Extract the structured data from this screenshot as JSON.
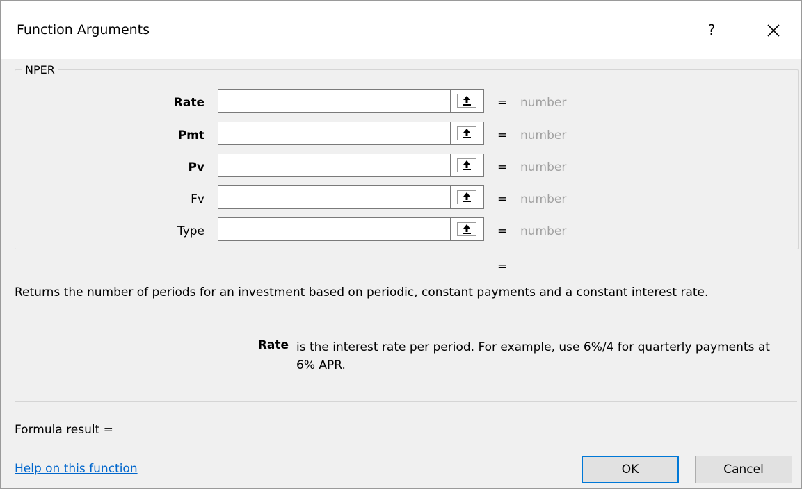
{
  "dialog": {
    "title": "Function Arguments",
    "help_glyph": "?",
    "close_icon": "close-icon"
  },
  "function_group": {
    "name": "NPER",
    "arguments": [
      {
        "label": "Rate",
        "bold": true,
        "value": "",
        "result_eq": "=",
        "result_value": "number"
      },
      {
        "label": "Pmt",
        "bold": true,
        "value": "",
        "result_eq": "=",
        "result_value": "number"
      },
      {
        "label": "Pv",
        "bold": true,
        "value": "",
        "result_eq": "=",
        "result_value": "number"
      },
      {
        "label": "Fv",
        "bold": false,
        "value": "",
        "result_eq": "=",
        "result_value": "number"
      },
      {
        "label": "Type",
        "bold": false,
        "value": "",
        "result_eq": "=",
        "result_value": "number"
      }
    ],
    "ref_icon": "collapse-dialog-icon"
  },
  "result_eq": "=",
  "description": "Returns the number of periods for an investment based on periodic, constant payments and a constant interest rate.",
  "argument_help": {
    "name": "Rate",
    "text": "is the interest rate per period. For example, use 6%/4 for quarterly payments at 6% APR."
  },
  "formula_result_label": "Formula result =",
  "help_link": "Help on this function",
  "buttons": {
    "ok": "OK",
    "cancel": "Cancel"
  },
  "colors": {
    "accent": "#0078d7",
    "link": "#0066cc",
    "placeholder_result": "#a0a0a0"
  }
}
